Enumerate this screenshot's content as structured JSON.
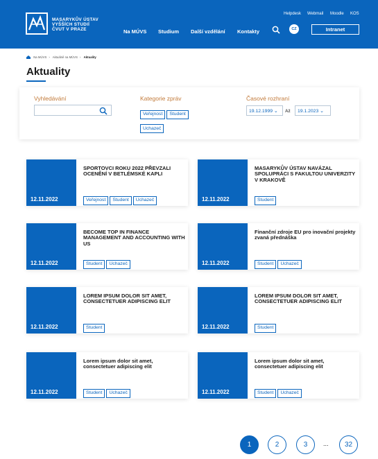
{
  "header": {
    "logo_lines": [
      "MASARYKŮV ÚSTAV",
      "VYŠŠÍCH STUDIÍ",
      "ČVUT V PRAZE"
    ],
    "top_links": [
      "Helpdesk",
      "Webmail",
      "Moodle",
      "KOS"
    ],
    "nav": [
      "Na MÚVS",
      "Studium",
      "Další vzdělání",
      "Kontakty"
    ],
    "lang": "CZ",
    "intranet": "Intranet"
  },
  "breadcrumb": [
    "Na MÚVS",
    "Aktuálně na MÚVS",
    "Aktuality"
  ],
  "page_title": "Aktuality",
  "filters": {
    "search_label": "Vyhledávání",
    "search_value": "",
    "category_label": "Kategorie zpráv",
    "categories": [
      "Veřejnost",
      "Student",
      "Uchazeč"
    ],
    "time_label": "Časové rozhraní",
    "date_from": "19.12.1999",
    "date_sep": "Až",
    "date_to": "19.1.2023"
  },
  "news": [
    {
      "date": "12.11.2022",
      "title": "SPORTOVCI ROKU 2022 PŘEVZALI OCENĚNÍ V BETLÉMSKÉ KAPLI",
      "tags": [
        "Veřejnost",
        "Student",
        "Uchazeč"
      ]
    },
    {
      "date": "12.11.2022",
      "title": "MASARYKŮV ÚSTAV NAVÁZAL SPOLUPRÁCI S FAKULTOU UNIVERZITY V KRAKOVĚ",
      "tags": [
        "Student"
      ]
    },
    {
      "date": "12.11.2022",
      "title": "BECOME TOP IN FINANCE MANAGEMENT AND ACCOUNTING WITH US",
      "tags": [
        "Student",
        "Uchazeč"
      ]
    },
    {
      "date": "12.11.2022",
      "title": "Finanční zdroje EU pro inovační projekty zvaná přednáška",
      "tags": [
        "Student",
        "Uchazeč"
      ]
    },
    {
      "date": "12.11.2022",
      "title": "LOREM IPSUM DOLOR SIT AMET, CONSECTETUER ADIPISCING ELIT",
      "tags": [
        "Student"
      ]
    },
    {
      "date": "12.11.2022",
      "title": "LOREM IPSUM DOLOR SIT AMET, CONSECTETUER ADIPISCING ELIT",
      "tags": [
        "Student"
      ]
    },
    {
      "date": "12.11.2022",
      "title": "Lorem ipsum dolor sit amet, consectetuer adipiscing elit",
      "tags": [
        "Student",
        "Uchazeč"
      ]
    },
    {
      "date": "12.11.2022",
      "title": "Lorem ipsum dolor sit amet, consectetuer adipiscing elit",
      "tags": [
        "Student",
        "Uchazeč"
      ]
    }
  ],
  "pagination": {
    "pages": [
      "1",
      "2",
      "3",
      "32"
    ],
    "ellipsis": "...",
    "current": "1"
  },
  "colors": {
    "primary": "#0a65bd",
    "label": "#c27a3a"
  },
  "icons": [
    "logo-icon",
    "search-icon",
    "home-icon",
    "chevron-down-icon"
  ]
}
